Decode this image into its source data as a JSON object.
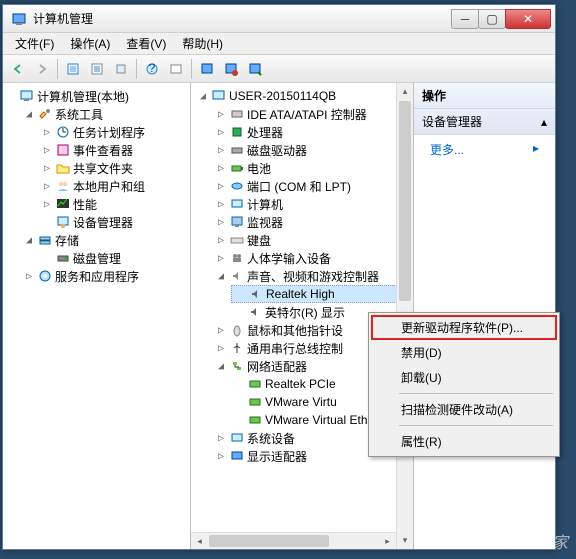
{
  "window": {
    "title": "计算机管理"
  },
  "menus": {
    "file": "文件(F)",
    "action": "操作(A)",
    "view": "查看(V)",
    "help": "帮助(H)"
  },
  "leftTree": {
    "root": "计算机管理(本地)",
    "systools": "系统工具",
    "task": "任务计划程序",
    "event": "事件查看器",
    "shared": "共享文件夹",
    "users": "本地用户和组",
    "perf": "性能",
    "devmgr": "设备管理器",
    "storage": "存储",
    "disk": "磁盘管理",
    "services": "服务和应用程序"
  },
  "midTree": {
    "root": "USER-20150114QB",
    "ide": "IDE ATA/ATAPI 控制器",
    "cpu": "处理器",
    "cdrom": "磁盘驱动器",
    "battery": "电池",
    "ports": "端口 (COM 和 LPT)",
    "computer": "计算机",
    "monitor": "监视器",
    "keyboard": "键盘",
    "hid": "人体学输入设备",
    "sound": "声音、视频和游戏控制器",
    "realtek": "Realtek High",
    "intel": "英特尔(R) 显示",
    "mouse": "鼠标和其他指针设",
    "usb": "通用串行总线控制",
    "net": "网络适配器",
    "pcie": "Realtek PCIe",
    "vmw1": "VMware Virtu",
    "vmw2": "VMware Virtual Etherne",
    "sysdev": "系统设备",
    "display": "显示适配器"
  },
  "actions": {
    "title": "操作",
    "section": "设备管理器",
    "more": "更多..."
  },
  "ctx": {
    "update": "更新驱动程序软件(P)...",
    "disable": "禁用(D)",
    "uninstall": "卸载(U)",
    "scan": "扫描检测硬件改动(A)",
    "props": "属性(R)"
  },
  "watermark": "系统之家"
}
